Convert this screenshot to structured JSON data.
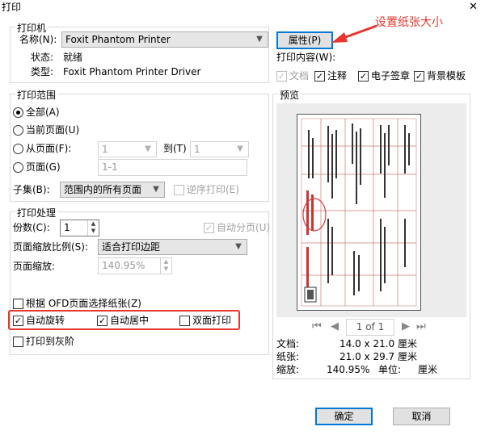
{
  "window": {
    "title": "打印",
    "close_glyph": "✕"
  },
  "annotation": {
    "text": "设置纸张大小",
    "color": "#e8352e"
  },
  "printer": {
    "group_label": "打印机",
    "name_label": "名称(N):",
    "name_value": "Foxit Phantom Printer",
    "status_label": "状态:",
    "status_value": "就绪",
    "type_label": "类型:",
    "type_value": "Foxit Phantom Printer Driver",
    "properties_button": "属性(P)"
  },
  "print_content": {
    "label": "打印内容(W):",
    "options": [
      {
        "label": "文档",
        "checked": true,
        "disabled": true
      },
      {
        "label": "注释",
        "checked": true,
        "disabled": false
      },
      {
        "label": "电子签章",
        "checked": true,
        "disabled": false
      },
      {
        "label": "背景模板",
        "checked": true,
        "disabled": false
      }
    ]
  },
  "range": {
    "group_label": "打印范围",
    "all_label": "全部(A)",
    "current_label": "当前页面(U)",
    "from_label": "从页面(F):",
    "from_value": "1",
    "to_label": "到(T)",
    "to_value": "1",
    "pages_label": "页面(G)",
    "pages_value": "1-1",
    "subset_label": "子集(B):",
    "subset_value": "范围内的所有页面",
    "reverse_label": "逆序打印(E)"
  },
  "handling": {
    "group_label": "打印处理",
    "copies_label": "份数(C):",
    "copies_value": "1",
    "collate_label": "自动分页(U)",
    "scaling_label": "页面缩放比例(S):",
    "scaling_value": "适合打印边距",
    "zoom_label": "页面缩放:",
    "zoom_value": "140.95%",
    "ofd_label": "根据 OFD页面选择纸张(Z)",
    "auto_rotate_label": "自动旋转",
    "auto_center_label": "自动居中",
    "duplex_label": "双面打印",
    "grayscale_label": "打印到灰阶",
    "highlight_color": "#e8352e"
  },
  "preview": {
    "group_label": "预览",
    "page_indicator": "1 of 1",
    "doc_label": "文档:",
    "doc_size": "14.0 x 21.0 厘米",
    "paper_label": "纸张:",
    "paper_size": "21.0 x 29.7 厘米",
    "zoom_label": "缩放:",
    "zoom_value": "140.95%",
    "unit_label": "单位:",
    "unit_value": "厘米"
  },
  "buttons": {
    "ok": "确定",
    "cancel": "取消"
  }
}
